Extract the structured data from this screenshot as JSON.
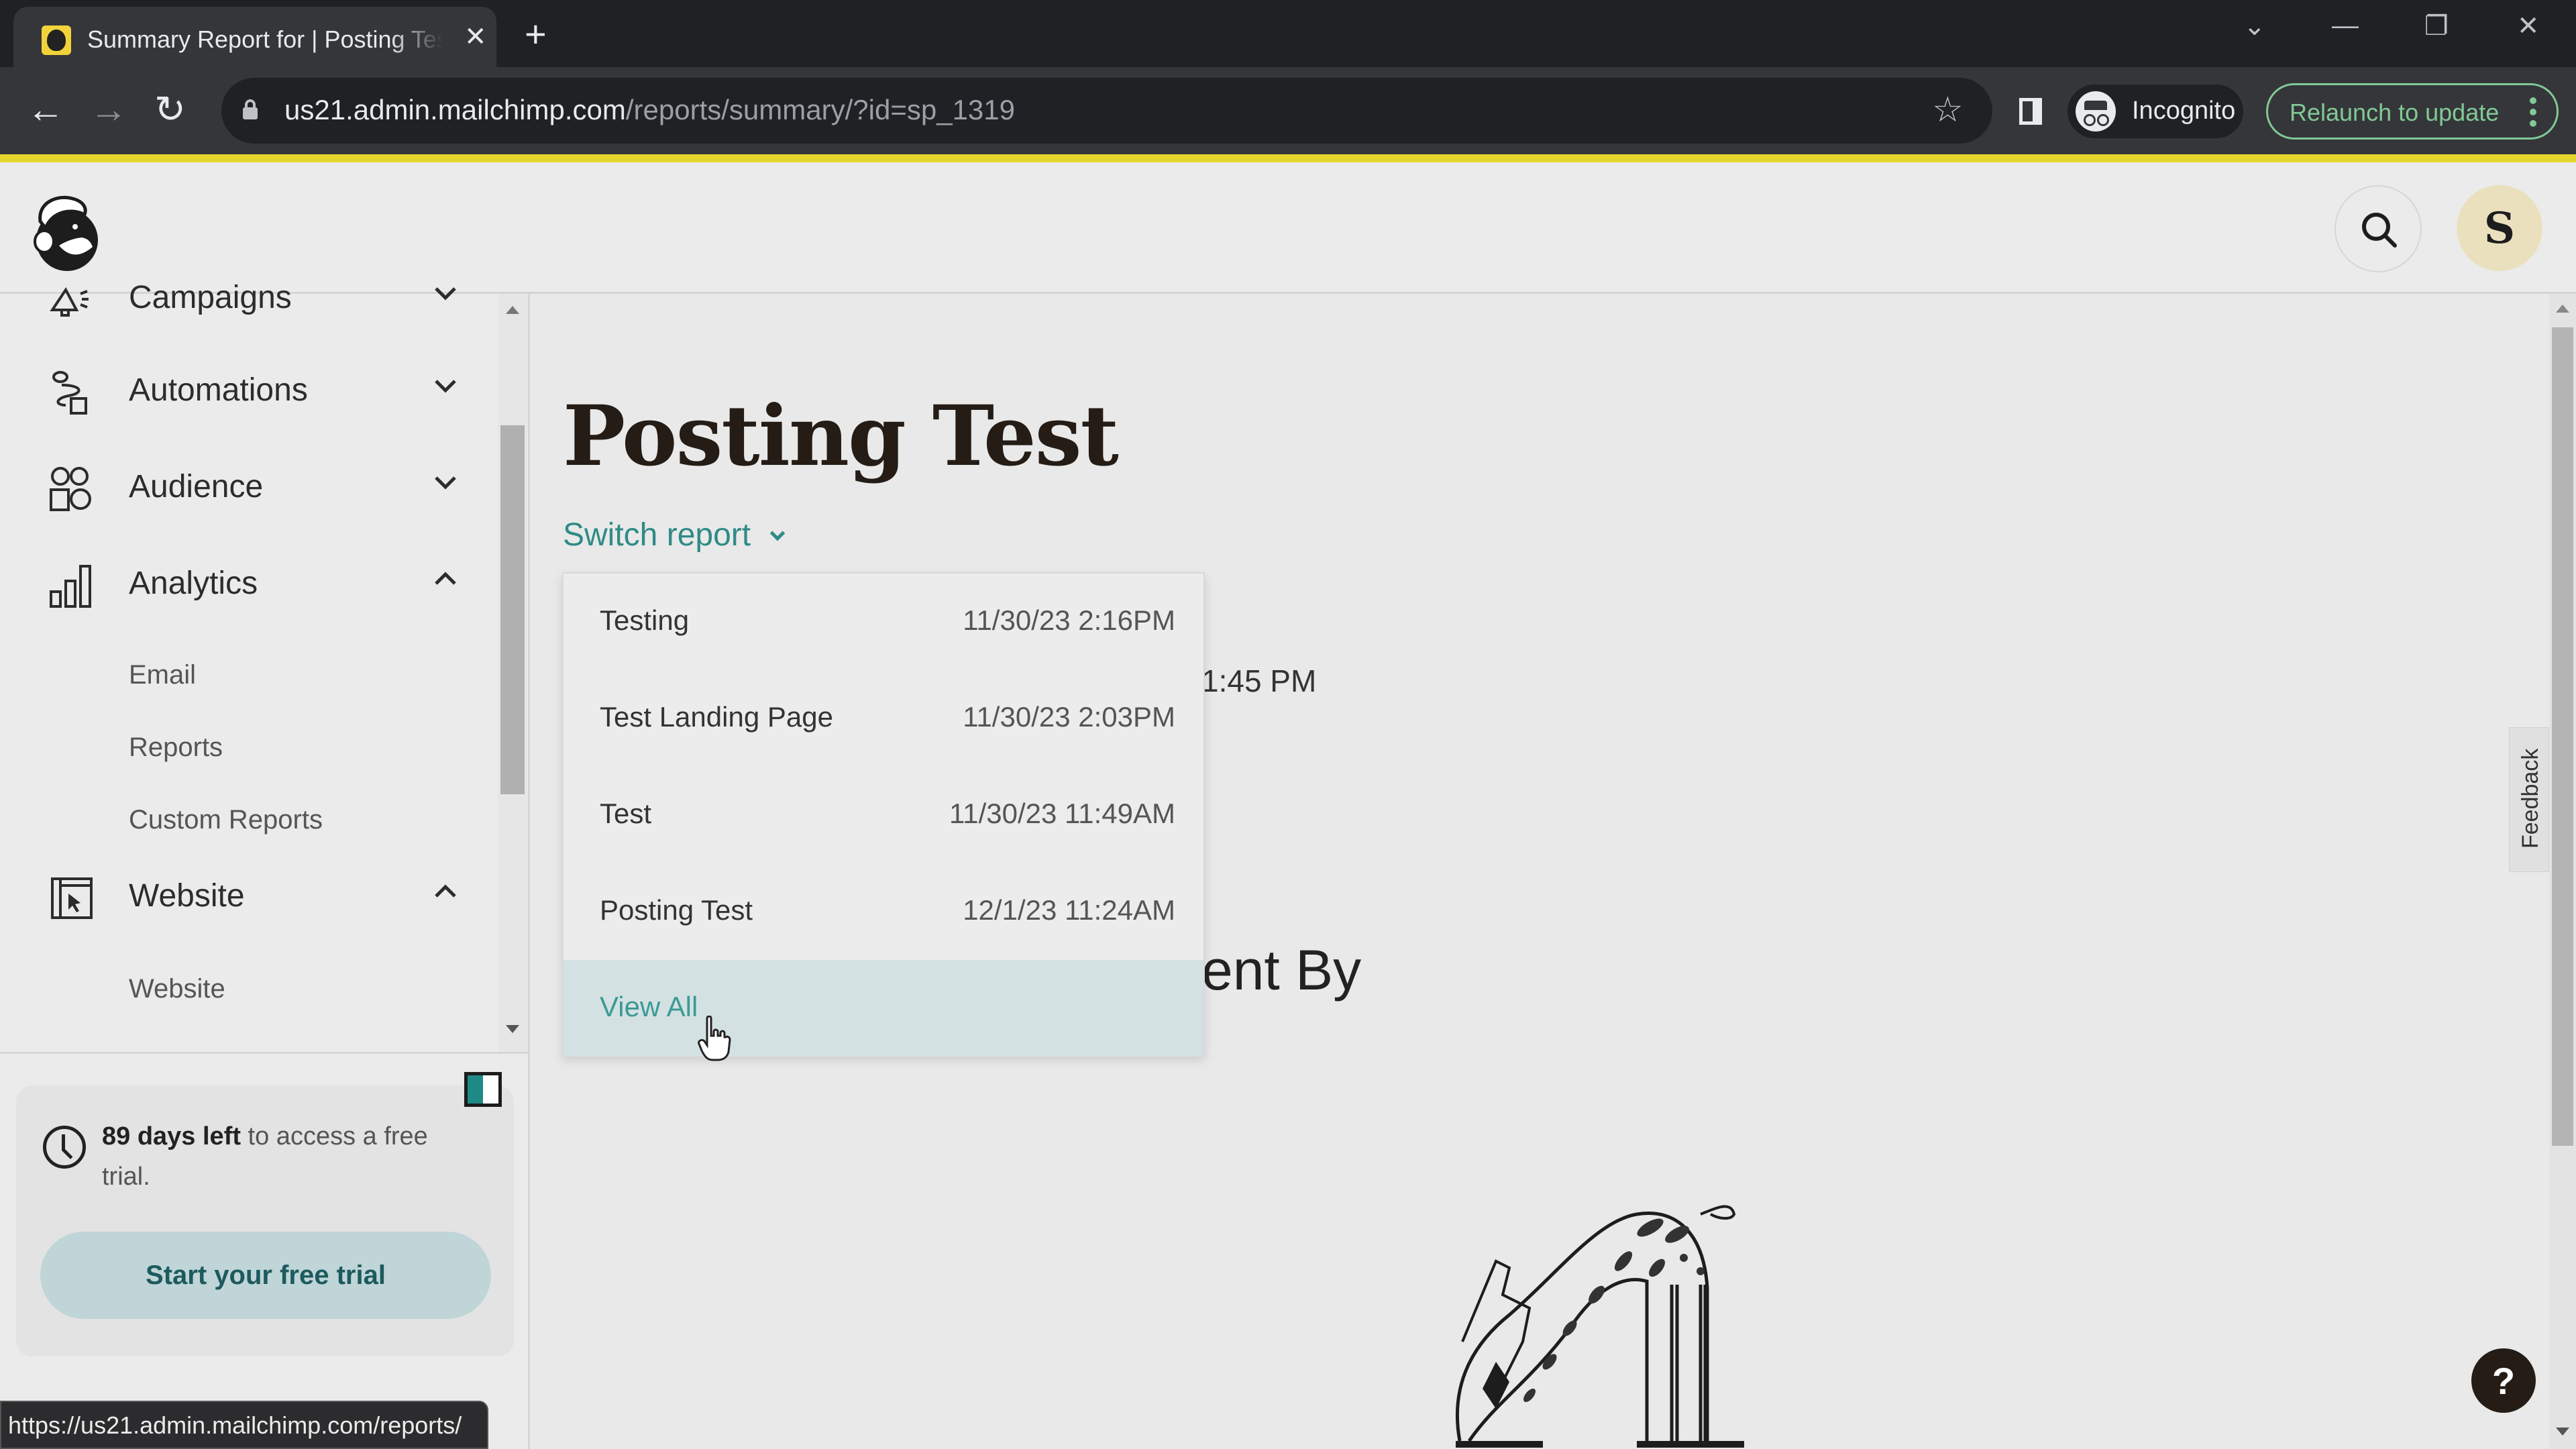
{
  "browser": {
    "tab_title": "Summary Report for | Posting Test",
    "url_host": "us21.admin.mailchimp.com",
    "url_path": "/reports/summary/?id=sp_1319",
    "incognito_label": "Incognito",
    "relaunch_label": "Relaunch to update",
    "status_url": "https://us21.admin.mailchimp.com/reports/",
    "icons": {
      "back": "←",
      "forward": "→",
      "reload": "↻",
      "star": "☆",
      "tab_close": "✕",
      "new_tab": "+",
      "tab_search": "⌄",
      "minimize": "—",
      "restore": "❐",
      "close": "✕"
    }
  },
  "header": {
    "avatar_initial": "S"
  },
  "sidebar": {
    "items": [
      {
        "label": "Campaigns",
        "icon": "megaphone-icon",
        "expanded": false
      },
      {
        "label": "Automations",
        "icon": "workflow-icon",
        "expanded": false
      },
      {
        "label": "Audience",
        "icon": "audience-icon",
        "expanded": false
      },
      {
        "label": "Analytics",
        "icon": "bar-chart-icon",
        "expanded": true,
        "children": [
          "Email",
          "Reports",
          "Custom Reports"
        ]
      },
      {
        "label": "Website",
        "icon": "website-cursor-icon",
        "expanded": true,
        "children": [
          "Website"
        ]
      }
    ],
    "trial": {
      "days_left": "89 days left",
      "rest": " to access a free trial.",
      "button": "Start your free trial"
    }
  },
  "main": {
    "title": "Posting Test",
    "switch_report_label": "Switch report",
    "behind_time": "1:45 PM",
    "behind_heading": "ent By",
    "dropdown": {
      "items": [
        {
          "name": "Testing",
          "date": "11/30/23 2:16PM"
        },
        {
          "name": "Test Landing Page",
          "date": "11/30/23 2:03PM"
        },
        {
          "name": "Test",
          "date": "11/30/23 11:49AM"
        },
        {
          "name": "Posting Test",
          "date": "12/1/23 11:24AM"
        }
      ],
      "view_all": "View All"
    },
    "feedback_label": "Feedback",
    "help_label": "?"
  },
  "colors": {
    "accent_teal": "#2f8b86",
    "brand_yellow": "#e6d52c",
    "relaunch_green": "#81c995",
    "dark": "#241c15"
  }
}
